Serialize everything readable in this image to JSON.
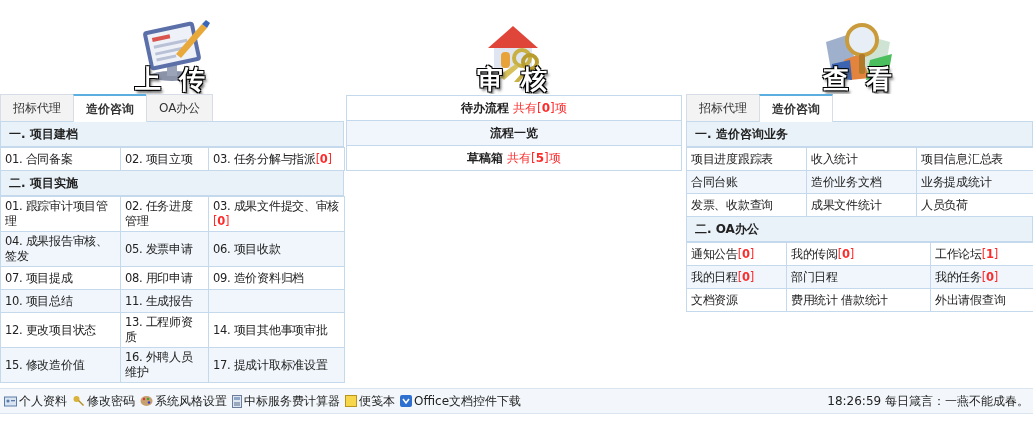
{
  "panels": [
    {
      "kind": "tabbed",
      "title": "上 传",
      "tabs": [
        {
          "label": "招标代理",
          "selected": false
        },
        {
          "label": "造价咨询",
          "selected": true
        },
        {
          "label": "OA办公",
          "selected": false
        }
      ],
      "sections": [
        {
          "heading": "一. 项目建档",
          "rows": [
            [
              {
                "text": "01. 合同备案"
              },
              {
                "text": "02. 项目立项"
              },
              {
                "text": "03. 任务分解与指派",
                "count": "[**0**]"
              }
            ]
          ]
        },
        {
          "heading": "二. 项目实施",
          "rows": [
            [
              {
                "text": "01. 跟踪审计项目管理"
              },
              {
                "text": "02. 任务进度管理"
              },
              {
                "text": "03. 成果文件提交、审核",
                "count": "[**0**]"
              }
            ],
            [
              {
                "text": "04. 成果报告审核、签发"
              },
              {
                "text": "05. 发票申请"
              },
              {
                "text": "06. 项目收款"
              }
            ],
            [
              {
                "text": "07. 项目提成"
              },
              {
                "text": "08. 用印申请"
              },
              {
                "text": "09. 造价资料归档"
              }
            ],
            [
              {
                "text": "10. 项目总结"
              },
              {
                "text": "11. 生成报告"
              }
            ],
            [
              {
                "text": "12. 更改项目状态"
              },
              {
                "text": "13. 工程师资质"
              },
              {
                "text": "14. 项目其他事项审批"
              }
            ],
            [
              {
                "text": "15. 修改造价值"
              },
              {
                "text": "16. 外聘人员维护"
              },
              {
                "text": "17. 提成计取标准设置"
              }
            ]
          ]
        }
      ]
    },
    {
      "kind": "list",
      "title": "审 核",
      "links": [
        {
          "label": "待办流程",
          "note": "共有[**0**]项"
        },
        {
          "label": "流程一览"
        },
        {
          "label": "草稿箱",
          "note": "共有[**5**]项"
        }
      ]
    },
    {
      "kind": "tabbed",
      "title": "查 看",
      "tabs": [
        {
          "label": "招标代理",
          "selected": false
        },
        {
          "label": "造价咨询",
          "selected": true
        }
      ],
      "sections": [
        {
          "heading": "一. 造价咨询业务",
          "rows": [
            [
              {
                "text": "项目进度跟踪表"
              },
              {
                "text": "收入统计"
              },
              {
                "text": "项目信息汇总表"
              }
            ],
            [
              {
                "text": "合同台账"
              },
              {
                "text": "造价业务文档"
              },
              {
                "text": "业务提成统计"
              }
            ],
            [
              {
                "text": "发票、收款查询"
              },
              {
                "text": "成果文件统计"
              },
              {
                "text": "人员负荷"
              }
            ]
          ]
        },
        {
          "heading": "二. OA办公",
          "rows": [
            [
              {
                "text": "通知公告",
                "count": "[**0**]"
              },
              {
                "text": "我的传阅",
                "count": "[**0**]"
              },
              {
                "text": "工作论坛",
                "count": "[**1**]"
              }
            ],
            [
              {
                "text": "我的日程",
                "count": "[**0**]"
              },
              {
                "text": "部门日程"
              },
              {
                "text": "我的任务",
                "count": "[**0**]"
              }
            ],
            [
              {
                "text": "文档资源"
              },
              {
                "text": "费用统计  借款统计"
              },
              {
                "text": "外出请假查询"
              }
            ]
          ]
        }
      ]
    }
  ],
  "footer": {
    "links": [
      "个人资料",
      "修改密码",
      "系统风格设置",
      "中标服务费计算器",
      "便笺本",
      "Office文档控件下载"
    ],
    "status": "18:26:59 每日箴言：一燕不能成春。"
  }
}
